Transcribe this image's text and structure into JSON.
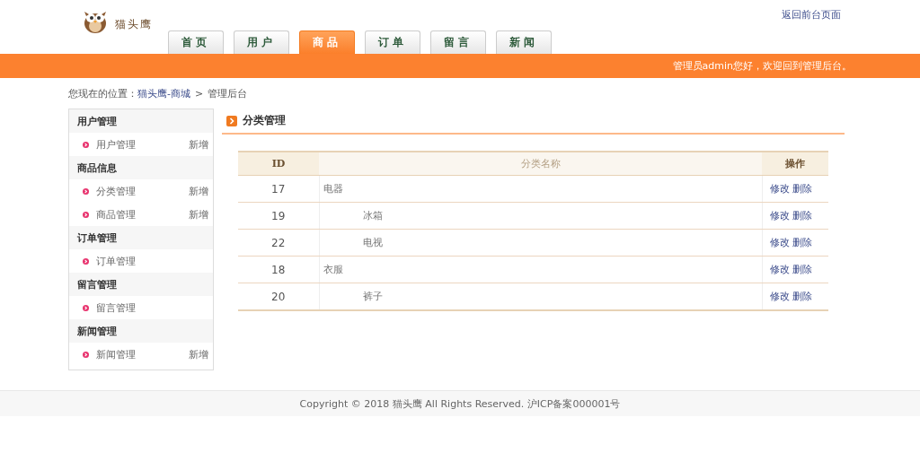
{
  "header": {
    "logo_text": "猫头鹰",
    "back_link": "返回前台页面"
  },
  "nav_tabs": [
    {
      "label": "首页",
      "selected": false
    },
    {
      "label": "用户",
      "selected": false
    },
    {
      "label": "商品",
      "selected": true
    },
    {
      "label": "订单",
      "selected": false
    },
    {
      "label": "留言",
      "selected": false
    },
    {
      "label": "新闻",
      "selected": false
    }
  ],
  "welcome_bar": "管理员admin您好，欢迎回到管理后台。",
  "breadcrumb": {
    "prefix": "您现在的位置：",
    "link": "猫头鹰-商城",
    "separator": ">",
    "current": "管理后台"
  },
  "sidebar": {
    "groups": [
      {
        "title": "用户管理",
        "items": [
          {
            "label": "用户管理",
            "action": "新增"
          }
        ]
      },
      {
        "title": "商品信息",
        "items": [
          {
            "label": "分类管理",
            "action": "新增"
          },
          {
            "label": "商品管理",
            "action": "新增"
          }
        ]
      },
      {
        "title": "订单管理",
        "items": [
          {
            "label": "订单管理"
          }
        ]
      },
      {
        "title": "留言管理",
        "items": [
          {
            "label": "留言管理"
          }
        ]
      },
      {
        "title": "新闻管理",
        "items": [
          {
            "label": "新闻管理",
            "action": "新增"
          }
        ]
      }
    ]
  },
  "panel": {
    "title": "分类管理",
    "table": {
      "columns": [
        "ID",
        "分类名称",
        "操作"
      ],
      "rows": [
        {
          "id": "17",
          "name": "电器",
          "actions": [
            "修改",
            "删除"
          ],
          "children": [
            {
              "id": "19",
              "name": "冰箱",
              "actions": [
                "修改",
                "删除"
              ]
            },
            {
              "id": "22",
              "name": "电视",
              "actions": [
                "修改",
                "删除"
              ]
            }
          ]
        },
        {
          "id": "18",
          "name": "衣服",
          "actions": [
            "修改",
            "删除"
          ],
          "children": [
            {
              "id": "20",
              "name": "裤子",
              "actions": [
                "修改",
                "删除"
              ]
            }
          ]
        }
      ]
    }
  },
  "footer": "Copyright © 2018 猫头鹰 All Rights Reserved. 沪ICP备案000001号"
}
